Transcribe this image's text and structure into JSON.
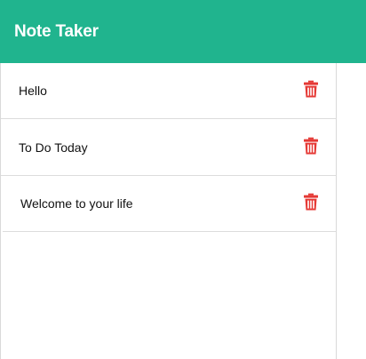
{
  "navbar": {
    "brand": "Note Taker",
    "color": "#20b48e"
  },
  "notes": [
    {
      "title": "Hello",
      "delete_icon": "trash-icon"
    },
    {
      "title": "To Do Today",
      "delete_icon": "trash-icon"
    },
    {
      "title": "Welcome to your life",
      "delete_icon": "trash-icon"
    }
  ],
  "colors": {
    "delete_icon": "#e53935"
  }
}
